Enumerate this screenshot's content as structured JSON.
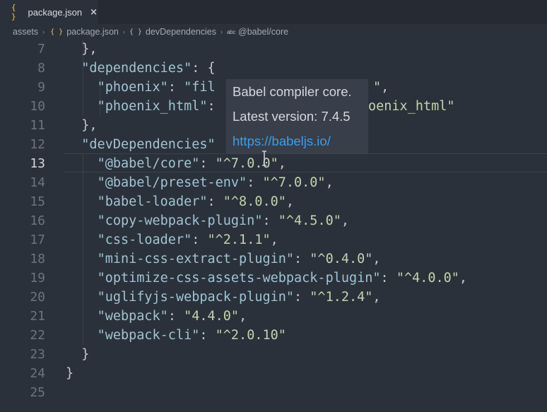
{
  "tab": {
    "icon": "json-braces-icon",
    "icon_glyph": "{ }",
    "label": "package.json",
    "close_glyph": "×"
  },
  "breadcrumb": {
    "items": [
      {
        "label": "assets",
        "icon": ""
      },
      {
        "label": "package.json",
        "icon": "json-braces-icon",
        "glyph": "{ }"
      },
      {
        "label": "devDependencies",
        "icon": "object-braces-icon",
        "glyph": "{ }"
      },
      {
        "label": "@babel/core",
        "icon": "string-abc-icon",
        "glyph": "abc"
      }
    ],
    "separator": "›"
  },
  "editor": {
    "active_line": 13,
    "lines": [
      {
        "num": "7",
        "text": "  },"
      },
      {
        "num": "8",
        "text": "  \"dependencies\": {"
      },
      {
        "num": "9",
        "text": "    \"phoenix\": \"fil"
      },
      {
        "num": "10",
        "text": "    \"phoenix_html\":"
      },
      {
        "num": "11",
        "text": "  },"
      },
      {
        "num": "12",
        "text": "  \"devDependencies\""
      },
      {
        "num": "13",
        "text": "    \"@babel/core\": \"^7.0.0\","
      },
      {
        "num": "14",
        "text": "    \"@babel/preset-env\": \"^7.0.0\","
      },
      {
        "num": "15",
        "text": "    \"babel-loader\": \"^8.0.0\","
      },
      {
        "num": "16",
        "text": "    \"copy-webpack-plugin\": \"^4.5.0\","
      },
      {
        "num": "17",
        "text": "    \"css-loader\": \"^2.1.1\","
      },
      {
        "num": "18",
        "text": "    \"mini-css-extract-plugin\": \"^0.4.0\","
      },
      {
        "num": "19",
        "text": "    \"optimize-css-assets-webpack-plugin\": \"^4.0.0\","
      },
      {
        "num": "20",
        "text": "    \"uglifyjs-webpack-plugin\": \"^1.2.4\","
      },
      {
        "num": "21",
        "text": "    \"webpack\": \"4.4.0\","
      },
      {
        "num": "22",
        "text": "    \"webpack-cli\": \"^2.0.10\""
      },
      {
        "num": "23",
        "text": "  }"
      },
      {
        "num": "24",
        "text": "}"
      },
      {
        "num": "25",
        "text": ""
      }
    ],
    "partial_fragments": {
      "line9_tail": "\",",
      "line10_tail": "oenix_html\""
    }
  },
  "hover": {
    "description": "Babel compiler core.",
    "latest_version": "Latest version: 7.4.5",
    "link": "https://babeljs.io/"
  },
  "colors": {
    "background": "#2b313b",
    "tabbar": "#262b33",
    "key": "#9fc4d3",
    "string": "#bfd4ae",
    "punctuation": "#c2c7cf",
    "line_number": "#6c7380",
    "line_number_active": "#d3d7de",
    "hover_bg": "#383e4a",
    "link": "#3e9de6",
    "json_icon": "#e8c35d"
  }
}
